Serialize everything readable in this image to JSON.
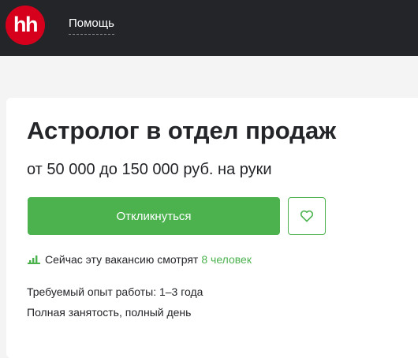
{
  "header": {
    "logo_text": "hh",
    "help_link": "Помощь"
  },
  "vacancy": {
    "title": "Астролог в отдел продаж",
    "salary": "от 50 000 до 150 000 руб. на руки",
    "respond_button": "Откликнуться",
    "viewers_text": "Сейчас эту вакансию смотрят",
    "viewers_count": "8 человек",
    "experience": "Требуемый опыт работы: 1–3 года",
    "employment": "Полная занятость, полный день"
  },
  "colors": {
    "header_bg": "#232529",
    "logo_red": "#d6001c",
    "accent_green": "#4bb24e"
  },
  "icons": {
    "favorite": "heart-icon",
    "viewers": "bar-chart-icon"
  }
}
